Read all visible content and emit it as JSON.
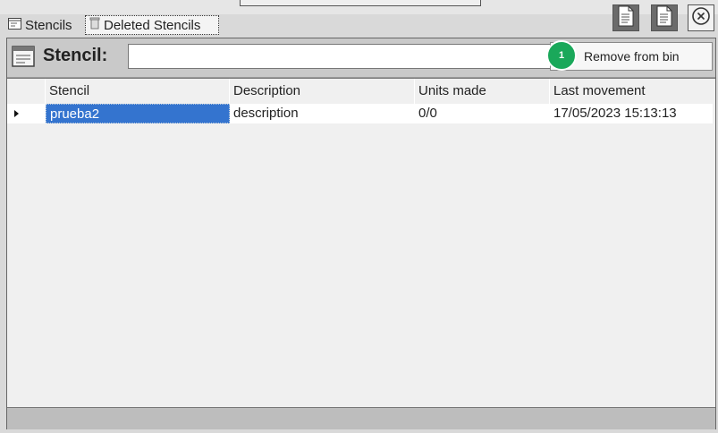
{
  "tabs": [
    {
      "label": "Stencils",
      "icon": "stencil-icon"
    },
    {
      "label": "Deleted Stencils",
      "icon": "trash-icon"
    }
  ],
  "toolbar_icons": [
    "document-export-icon",
    "document-export-icon",
    "close-circle-icon"
  ],
  "filter": {
    "label": "Stencil:",
    "value": "",
    "icon": "stencil-icon"
  },
  "action": {
    "label": "Remove from bin",
    "badge": "1"
  },
  "grid": {
    "columns": [
      "Stencil",
      "Description",
      "Units made",
      "Last movement"
    ],
    "rows": [
      {
        "stencil": "prueba2",
        "description": "description",
        "units_made": "0/0",
        "last_movement": "17/05/2023 15:13:13",
        "selected": true
      }
    ]
  },
  "colors": {
    "selection": "#3474cf",
    "badge": "#1aa85a",
    "toolbar_button": "#6b6b6b"
  }
}
